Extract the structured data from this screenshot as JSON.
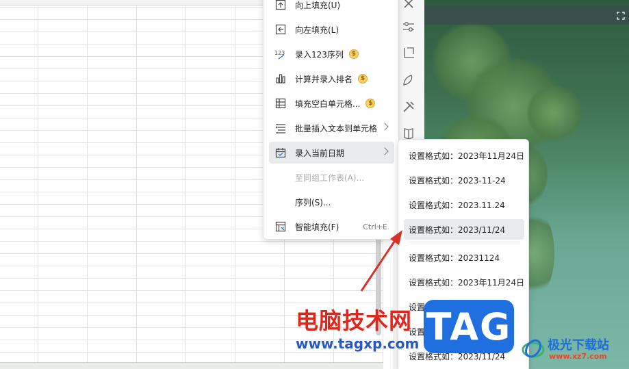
{
  "fill_menu": {
    "items": [
      {
        "label": "向上填充(U)",
        "icon": "fill-up-icon"
      },
      {
        "label": "向左填充(L)",
        "icon": "fill-left-icon"
      },
      {
        "label": "录入123序列",
        "icon": "number-sequence-icon",
        "badge": "$"
      },
      {
        "label": "计算并录入排名",
        "icon": "rank-chart-icon",
        "badge": "$"
      },
      {
        "label": "填充空白单元格...",
        "icon": "table-grid-icon",
        "badge": "$"
      },
      {
        "label": "批量插入文本到单元格",
        "icon": "insert-text-icon",
        "has_submenu": true
      },
      {
        "label": "录入当前日期",
        "icon": "calendar-icon",
        "has_submenu": true,
        "highlighted": true
      },
      {
        "label": "至同组工作表(A)...",
        "disabled": true
      },
      {
        "label": "序列(S)..."
      },
      {
        "label": "智能填充(F)",
        "icon": "smart-fill-icon",
        "shortcut": "Ctrl+E"
      }
    ]
  },
  "date_submenu": {
    "items": [
      {
        "label": "设置格式如：2023年11月24日"
      },
      {
        "label": "设置格式如：2023-11-24"
      },
      {
        "label": "设置格式如：2023.11.24"
      },
      {
        "label": "设置格式如：2023/11/24",
        "highlighted": true
      },
      {
        "label": "设置格式如：20231124"
      },
      {
        "label": "设置格式如：2023年11月24日"
      },
      {
        "label": "设置格式如：2023-11-24"
      },
      {
        "label": "设置格式如：2023.11.24"
      },
      {
        "label": "设置格式如：2023/11/24"
      }
    ]
  },
  "watermark": {
    "title": "电脑技术网",
    "url": "www.tagxp.com",
    "tag": "TAG",
    "site_name": "极光下载站",
    "site_url": "www.xz7.com"
  },
  "colors": {
    "arrow": "#d8332a",
    "badge": "#f7d16a",
    "tag_bg": "#1f6fe0",
    "hover": "#e9eaec"
  }
}
